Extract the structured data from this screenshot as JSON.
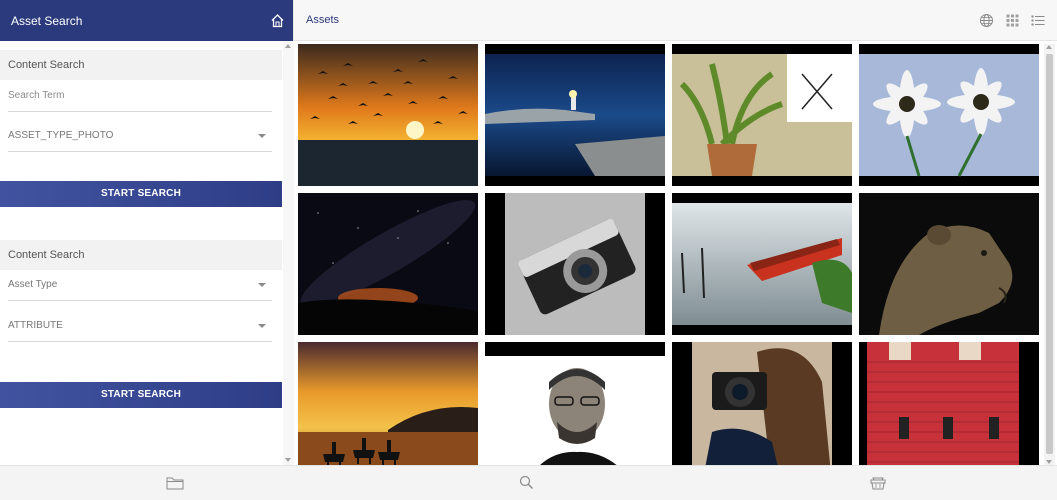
{
  "left_panel": {
    "title": "Asset Search",
    "icon": "home-icon",
    "search_form_1": {
      "section_title": "Content Search",
      "search_term_placeholder": "Search Term",
      "asset_type_value": "ASSET_TYPE_PHOTO",
      "button_label": "START SEARCH"
    },
    "search_form_2": {
      "section_title": "Content Search",
      "asset_type_value": "Asset Type",
      "attribute_value": "ATTRIBUTE",
      "button_label": "START SEARCH"
    }
  },
  "right_panel": {
    "title": "Assets",
    "header_icons": [
      "globe-icon",
      "grid-view-icon",
      "list-view-icon"
    ],
    "thumbnails": [
      "birds-sunset",
      "lighthouse-night",
      "potted-plant",
      "daisies",
      "milky-way-night",
      "vintage-camera",
      "red-rowboat",
      "lioness",
      "horse-riders-sunset",
      "portrait-man",
      "photographer-woman",
      "red-building"
    ]
  },
  "bottom_bar": {
    "icons": [
      "folder-icon",
      "search-icon",
      "basket-icon"
    ]
  },
  "colors": {
    "primary": "#2b3a7d",
    "button_gradient_start": "#4153a0",
    "button_gradient_end": "#2e3d86",
    "section_bg": "#f2f2f2"
  }
}
